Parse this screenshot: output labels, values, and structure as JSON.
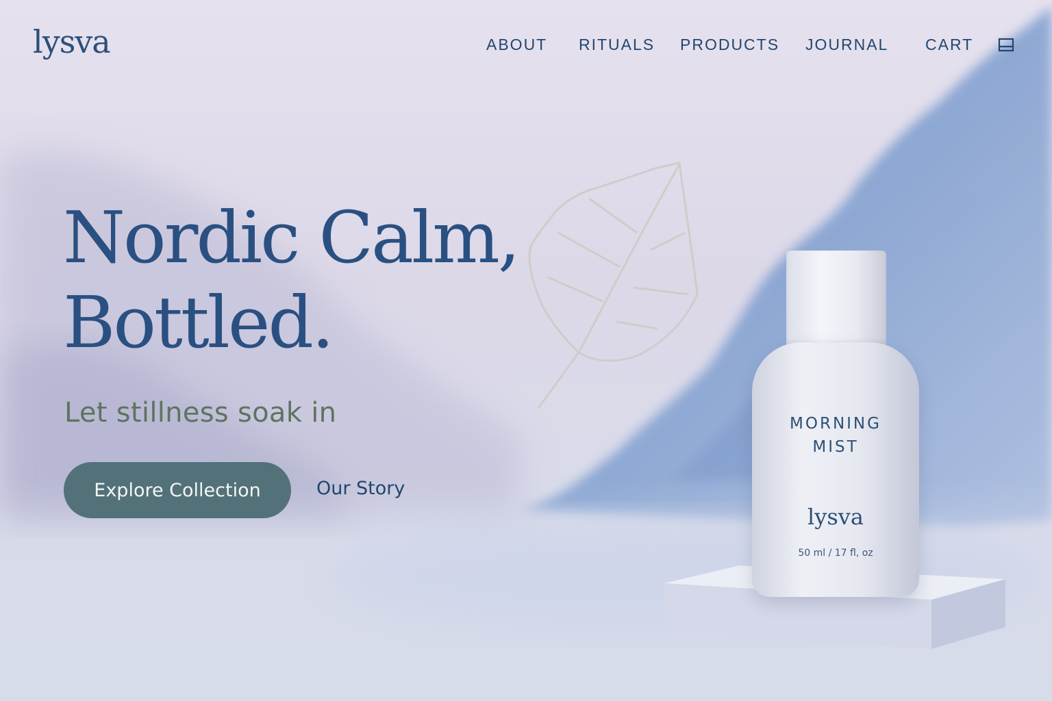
{
  "brand": {
    "logo_text": "lysva"
  },
  "nav": {
    "items": [
      {
        "label": "ABOUT"
      },
      {
        "label": "RITUALS"
      },
      {
        "label": "PRODUCTS"
      },
      {
        "label": "JOURNAL"
      },
      {
        "label": "CART"
      }
    ],
    "cart_icon": "shopping-bag-icon"
  },
  "hero": {
    "title_line1": "Nordic Calm,",
    "title_line2": "Bottled.",
    "subtitle": "Let stillness soak in",
    "primary_cta": "Explore Collection",
    "secondary_cta": "Our Story",
    "decoration_icon": "birch-leaf-icon"
  },
  "product": {
    "name": "MORNING\nMIST",
    "brand": "lysva",
    "volume": "50 ml / 17 fl, oz"
  },
  "colors": {
    "primary_text": "#2a5081",
    "button_bg": "#537178",
    "subtitle_green": "#5e7461",
    "background": "#e2dfec",
    "mountain_blue": "#7f9fcf"
  }
}
